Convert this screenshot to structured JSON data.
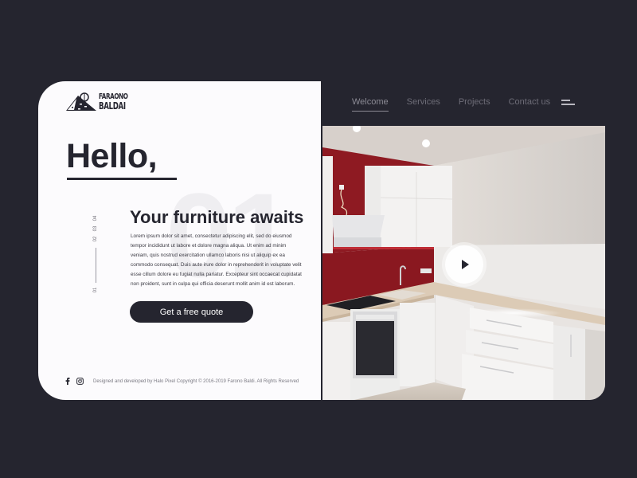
{
  "brand": {
    "name_line1": "FARAONO",
    "name_line2": "BALDAI"
  },
  "nav": {
    "items": [
      {
        "label": "Welcome",
        "active": true
      },
      {
        "label": "Services",
        "active": false
      },
      {
        "label": "Projects",
        "active": false
      },
      {
        "label": "Contact us",
        "active": false
      }
    ],
    "menu_icon": "hamburger-menu-icon"
  },
  "hero": {
    "greeting": "Hello,",
    "watermark_number": "01",
    "subtitle": "Your furniture awaits",
    "body": "Lorem ipsum dolor sit amet, consectetur adipiscing elit, sed do eiusmod tempor incididunt ut labore et dolore magna aliqua. Ut enim ad minim veniam, quis nostrud exercitation ullamco laboris nisi ut aliquip ex ea commodo consequat. Duis aute irure dolor in reprehenderit in voluptate velit esse cillum dolore eu fugiat nulla pariatur. Excepteur sint occaecat cupidatat non proident, sunt in culpa qui officia deserunt mollit anim id est laborum.",
    "cta_label": "Get a free quote"
  },
  "slides": {
    "numbers": [
      "04",
      "03",
      "02",
      "01"
    ],
    "current": "01"
  },
  "footer": {
    "social": [
      "facebook-icon",
      "instagram-icon"
    ],
    "copyright": "Designed and developed by Halo Pixel Copyright © 2016-2019 Farono Baldi. All Rights Reserved"
  },
  "media": {
    "alt": "Modern white kitchen with red backsplash",
    "play_icon": "play-icon"
  },
  "colors": {
    "background": "#25252f",
    "card": "#fcfbfd",
    "text_dark": "#25252f",
    "nav_text": "#6e6d78",
    "accent_red": "#8e1a22"
  }
}
